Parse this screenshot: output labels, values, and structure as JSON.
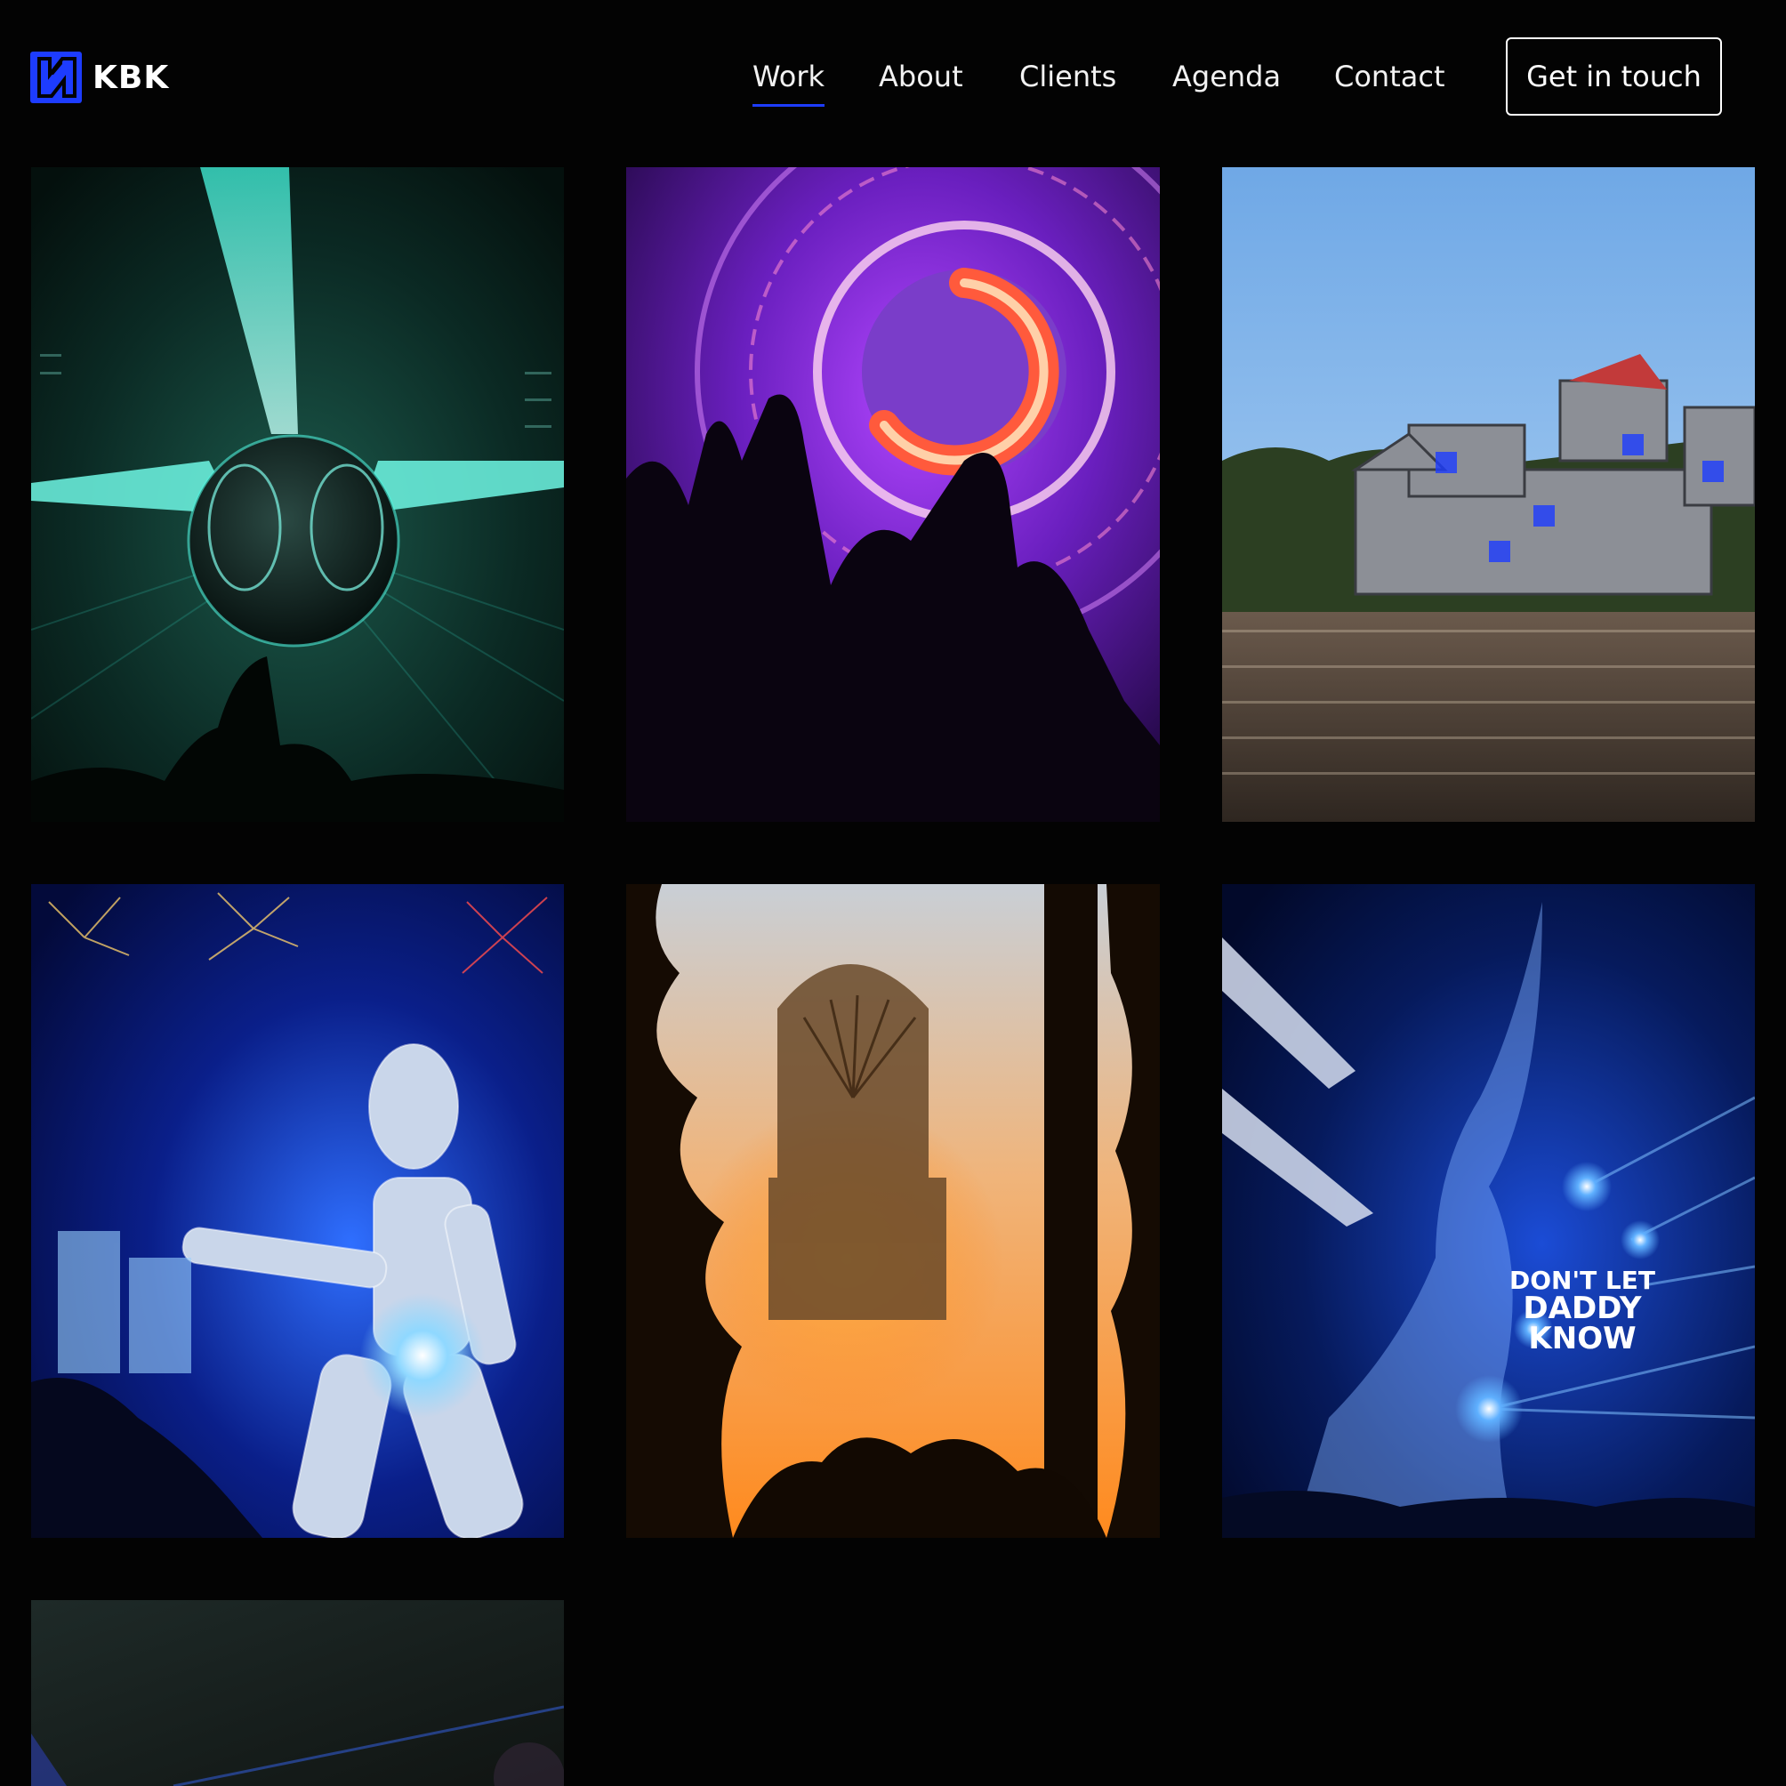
{
  "brand": {
    "name": "KBK",
    "accent": "#1d3cff"
  },
  "nav": {
    "items": [
      "Work",
      "About",
      "Clients",
      "Agenda",
      "Contact"
    ],
    "active": "Work",
    "cta_label": "Get in touch"
  },
  "gallery": {
    "columns": 3,
    "tiles": [
      {
        "subject": "teal lasers and mirror ball over crowd",
        "palette": [
          "#0b2a24",
          "#3ff0d8"
        ]
      },
      {
        "subject": "purple circular stage with raised hands",
        "palette": [
          "#5a1a9e",
          "#ff5a3c"
        ]
      },
      {
        "subject": "festival stage structure with large crowd under blue sky",
        "palette": [
          "#8fc1ef",
          "#4a4a4a"
        ]
      },
      {
        "subject": "glittering giant figure with fireworks",
        "palette": [
          "#0a1f8a",
          "#c9d6ea"
        ]
      },
      {
        "subject": "stage glowing orange behind trees at sunset",
        "palette": [
          "#1a0e04",
          "#ff9a33"
        ]
      },
      {
        "subject": "blue lights and smoke over stage",
        "palette": [
          "#061a5c",
          "#2f6fff"
        ],
        "stage_text": [
          "DON'T LET",
          "DADDY",
          "KNOW"
        ]
      },
      {
        "subject": "dark stage with light beams",
        "palette": [
          "#141816",
          "#2a3a6a"
        ]
      }
    ]
  }
}
